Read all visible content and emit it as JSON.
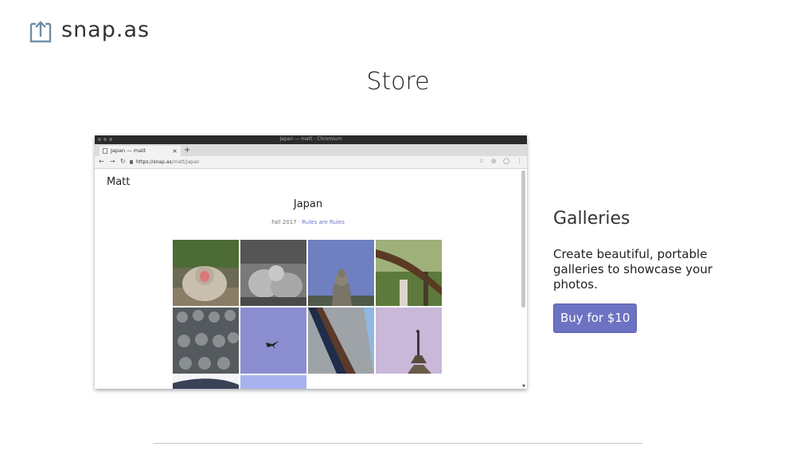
{
  "header": {
    "logo_text": "snap.as",
    "logo_icon": "upload-arrow-icon"
  },
  "page": {
    "title": "Store"
  },
  "screenshot": {
    "window_title": "Japan — matt - Chromium",
    "tab_title": "Japan — matt",
    "tab_close": "×",
    "new_tab": "+",
    "url_host": "https://snap.as",
    "url_path": "/matt/japan",
    "user": "Matt",
    "gallery_title": "Japan",
    "gallery_sub_prefix": "Fall 2017 · ",
    "gallery_sub_link": "Rules are Rules"
  },
  "product": {
    "name": "Galleries",
    "description": "Create beautiful, portable galleries to showcase your photos.",
    "buy_label": "Buy for $10"
  }
}
